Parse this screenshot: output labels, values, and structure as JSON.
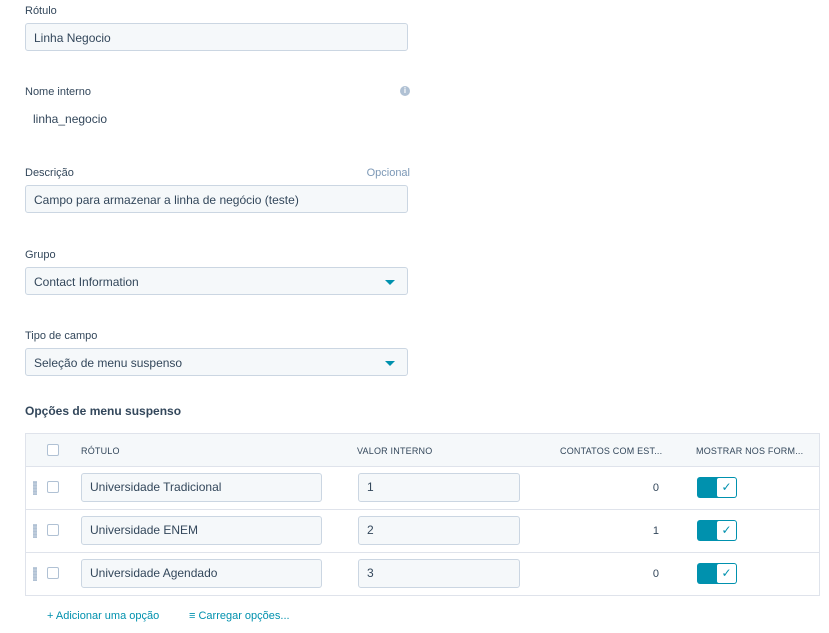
{
  "form": {
    "label": {
      "title": "Rótulo",
      "value": "Linha Negocio"
    },
    "internal_name": {
      "title": "Nome interno",
      "value": "linha_negocio",
      "info_icon": "i"
    },
    "description": {
      "title": "Descrição",
      "optional": "Opcional",
      "value": "Campo para armazenar a linha de negócio (teste)"
    },
    "group": {
      "title": "Grupo",
      "value": "Contact Information"
    },
    "field_type": {
      "title": "Tipo de campo",
      "value": "Seleção de menu suspenso"
    }
  },
  "options": {
    "section_title": "Opções de menu suspenso",
    "columns": [
      "RÓTULO",
      "VALOR INTERNO",
      "CONTATOS COM EST...",
      "MOSTRAR NOS FORM..."
    ],
    "rows": [
      {
        "label": "Universidade Tradicional",
        "value": "1",
        "count": "0",
        "show": true
      },
      {
        "label": "Universidade ENEM",
        "value": "2",
        "count": "1",
        "show": true
      },
      {
        "label": "Universidade Agendado",
        "value": "3",
        "count": "0",
        "show": true
      }
    ],
    "toggle_check": "✓",
    "add_option": "+ Adicionar uma opção",
    "load_options": "≡ Carregar opções..."
  },
  "colors": {
    "accent": "#0091ae",
    "text": "#33475b",
    "border": "#cbd6e2",
    "field_bg": "#f5f8fa"
  }
}
